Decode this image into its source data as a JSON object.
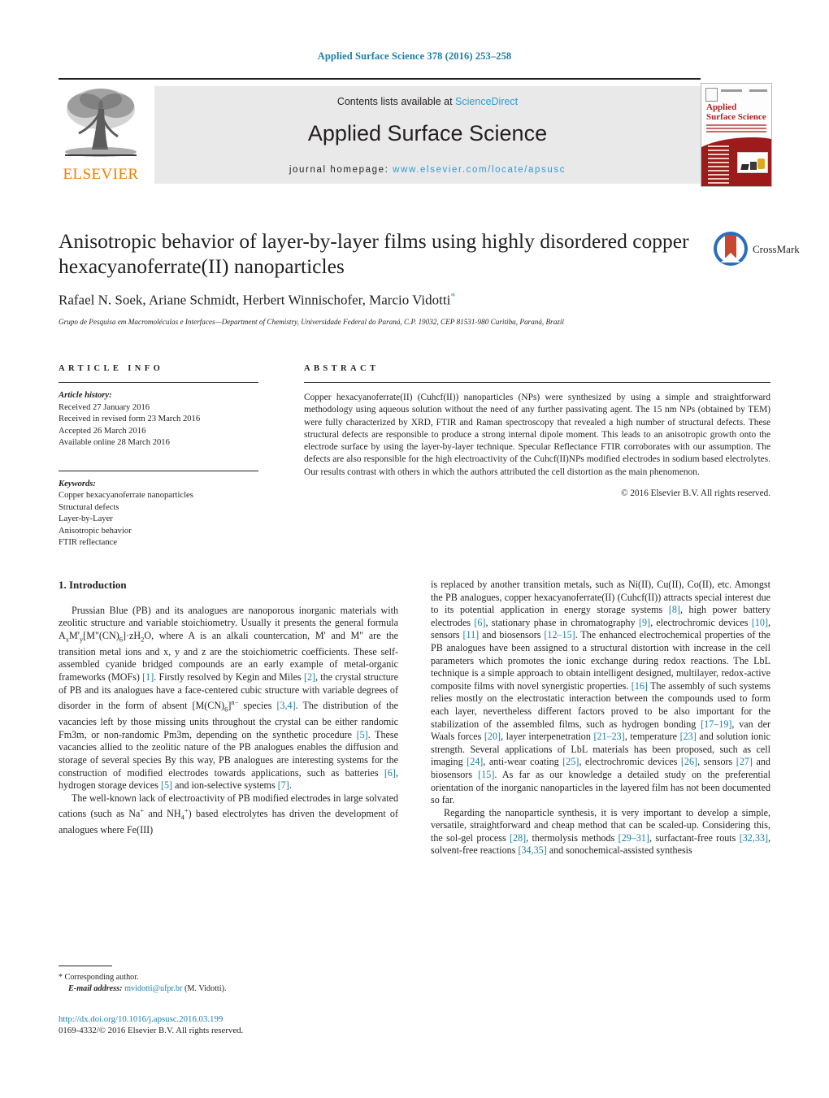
{
  "running_head": "Applied Surface Science 378 (2016) 253–258",
  "masthead": {
    "contents_prefix": "Contents lists available at ",
    "sciencedirect": "ScienceDirect",
    "journal_title": "Applied Surface Science",
    "homepage_prefix": "journal homepage: ",
    "homepage_url": "www.elsevier.com/locate/apsusc",
    "publisher": "ELSEVIER",
    "cover_title_line1": "Applied",
    "cover_title_line2": "Surface Science"
  },
  "article": {
    "title": "Anisotropic behavior of layer-by-layer films using highly disordered copper hexacyanoferrate(II) nanoparticles",
    "authors": "Rafael N. Soek, Ariane Schmidt, Herbert Winnischofer, Marcio Vidotti",
    "corresponding_marker": "*",
    "affiliation": "Grupo de Pesquisa em Macromoléculas e Interfaces—Department of Chemistry, Universidade Federal do Paraná, C.P. 19032, CEP 81531-980 Curitiba, Paraná, Brazil",
    "crossmark_label": "CrossMark"
  },
  "article_info": {
    "heading": "ARTICLE INFO",
    "history_title": "Article history:",
    "history": [
      "Received 27 January 2016",
      "Received in revised form 23 March 2016",
      "Accepted 26 March 2016",
      "Available online 28 March 2016"
    ],
    "keywords_title": "Keywords:",
    "keywords": [
      "Copper hexacyanoferrate nanoparticles",
      "Structural defects",
      "Layer-by-Layer",
      "Anisotropic behavior",
      "FTIR reflectance"
    ]
  },
  "abstract": {
    "heading": "ABSTRACT",
    "text_p1": "Copper hexacyanoferrate(II) (Cuhcf(II)) nanoparticles (NPs) were synthesized by using a simple and straightforward methodology using aqueous solution without the need of any further passivating agent. The 15 nm NPs (obtained by TEM) were fully characterized by XRD, FTIR and Raman spectroscopy that revealed a high number of structural defects. These structural defects are responsible to produce a strong internal dipole moment. This leads to an anisotropic growth onto the electrode surface by using the layer-by-layer technique. Specular Reflectance FTIR corroborates with our assumption. The defects are also responsible for the high electroactivity of the Cuhcf(II)NPs modified electrodes in sodium based electrolytes. Our results contrast with others in which the authors attributed the cell distortion as the main phenomenon.",
    "copyright": "© 2016 Elsevier B.V. All rights reserved."
  },
  "body": {
    "section_heading": "1. Introduction",
    "left_p1_a": "Prussian Blue (PB) and its analogues are nanoporous inorganic materials with zeolitic structure and variable stoichiometry. Usually it presents the general formula A",
    "left_p1_b": "M'",
    "left_p1_c": "[M\"(CN)",
    "left_p1_d": "]·zH",
    "left_p1_e": "O, where A is an alkali countercation, M' and M\" are the transition metal ions and x, y and z are the stoichiometric coefficients. These self-assembled cyanide bridged compounds are an early example of metal-organic frameworks (MOFs) ",
    "ref1": "[1]",
    "left_p1_f": ". Firstly resolved by Kegin and Miles ",
    "ref2": "[2]",
    "left_p1_g": ", the crystal structure of PB and its analogues have a face-centered cubic structure with variable degrees of disorder in the form of absent [M(CN)",
    "left_p1_h": "]",
    "left_p1_i": " species ",
    "ref34": "[3,4]",
    "left_p1_j": ". The distribution of the vacancies left by those missing units throughout the crystal can be either randomic Fm3m, or non-randomic Pm3m, depending on the synthetic procedure ",
    "ref5": "[5]",
    "left_p1_k": ". These vacancies allied to the zeolitic nature of the PB analogues enables the diffusion and storage of several species By this way, PB analogues are interesting systems for the construction of modified electrodes towards applications, such as batteries ",
    "ref6": "[6]",
    "left_p1_l": ", hydrogen storage devices ",
    "ref5b": "[5]",
    "left_p1_m": " and ion-selective systems ",
    "ref7": "[7]",
    "left_p1_n": ".",
    "left_p2_a": "The well-known lack of electroactivity of PB modified electrodes in large solvated cations (such as Na",
    "left_p2_b": " and NH",
    "left_p2_c": ") based electrolytes has driven the development of analogues where Fe(III)",
    "right_p1_a": "is replaced by another transition metals, such as Ni(II), Cu(II), Co(II), etc. Amongst the PB analogues, copper hexacyanoferrate(II) (Cuhcf(II)) attracts special interest due to its potential application in energy storage systems ",
    "ref8": "[8]",
    "right_p1_b": ", high power battery electrodes ",
    "ref6b": "[6]",
    "right_p1_c": ", stationary phase in chromatography ",
    "ref9": "[9]",
    "right_p1_d": ", electrochromic devices ",
    "ref10": "[10]",
    "right_p1_e": ", sensors ",
    "ref11": "[11]",
    "right_p1_f": " and biosensors ",
    "ref1215": "[12–15]",
    "right_p1_g": ". The enhanced electrochemical properties of the PB analogues have been assigned to a structural distortion with increase in the cell parameters which promotes the ionic exchange during redox reactions. The LbL technique is a simple approach to obtain intelligent designed, multilayer, redox-active composite films with novel synergistic properties. ",
    "ref16": "[16]",
    "right_p1_h": " The assembly of such systems relies mostly on the electrostatic interaction between the compounds used to form each layer, nevertheless different factors proved to be also important for the stabilization of the assembled films, such as hydrogen bonding ",
    "ref1719": "[17–19]",
    "right_p1_i": ", van der Waals forces ",
    "ref20": "[20]",
    "right_p1_j": ", layer interpenetration ",
    "ref2123": "[21–23]",
    "right_p1_k": ", temperature ",
    "ref23": "[23]",
    "right_p1_l": " and solution ionic strength. Several applications of LbL materials has been proposed, such as cell imaging ",
    "ref24": "[24]",
    "right_p1_m": ", anti-wear coating ",
    "ref25": "[25]",
    "right_p1_n": ", electrochromic devices ",
    "ref26": "[26]",
    "right_p1_o": ", sensors ",
    "ref27": "[27]",
    "right_p1_p": " and biosensors ",
    "ref15": "[15]",
    "right_p1_q": ". As far as our knowledge a detailed study on the preferential orientation of the inorganic nanoparticles in the layered film has not been documented so far.",
    "right_p2_a": "Regarding the nanoparticle synthesis, it is very important to develop a simple, versatile, straightforward and cheap method that can be scaled-up. Considering this, the sol-gel process ",
    "ref28": "[28]",
    "right_p2_b": ", thermolysis methods ",
    "ref2931": "[29–31]",
    "right_p2_c": ", surfactant-free routs ",
    "ref3233": "[32,33]",
    "right_p2_d": ", solvent-free reactions ",
    "ref3435": "[34,35]",
    "right_p2_e": " and sonochemical-assisted synthesis"
  },
  "footnote": {
    "star": "*",
    "corresponding": " Corresponding author.",
    "email_label": "E-mail address:",
    "email": "mvidotti@ufpr.br",
    "email_suffix": " (M. Vidotti)."
  },
  "footer": {
    "doi": "http://dx.doi.org/10.1016/j.apsusc.2016.03.199",
    "issn_copyright": "0169-4332/© 2016 Elsevier B.V. All rights reserved."
  },
  "colors": {
    "link_blue": "#1a7fa8",
    "sciencedirect_blue": "#2e9bd6",
    "elsevier_orange": "#f08000",
    "cover_red": "#9e1b1b",
    "crossmark_blue": "#2a6ebb",
    "crossmark_red": "#c8482f"
  }
}
